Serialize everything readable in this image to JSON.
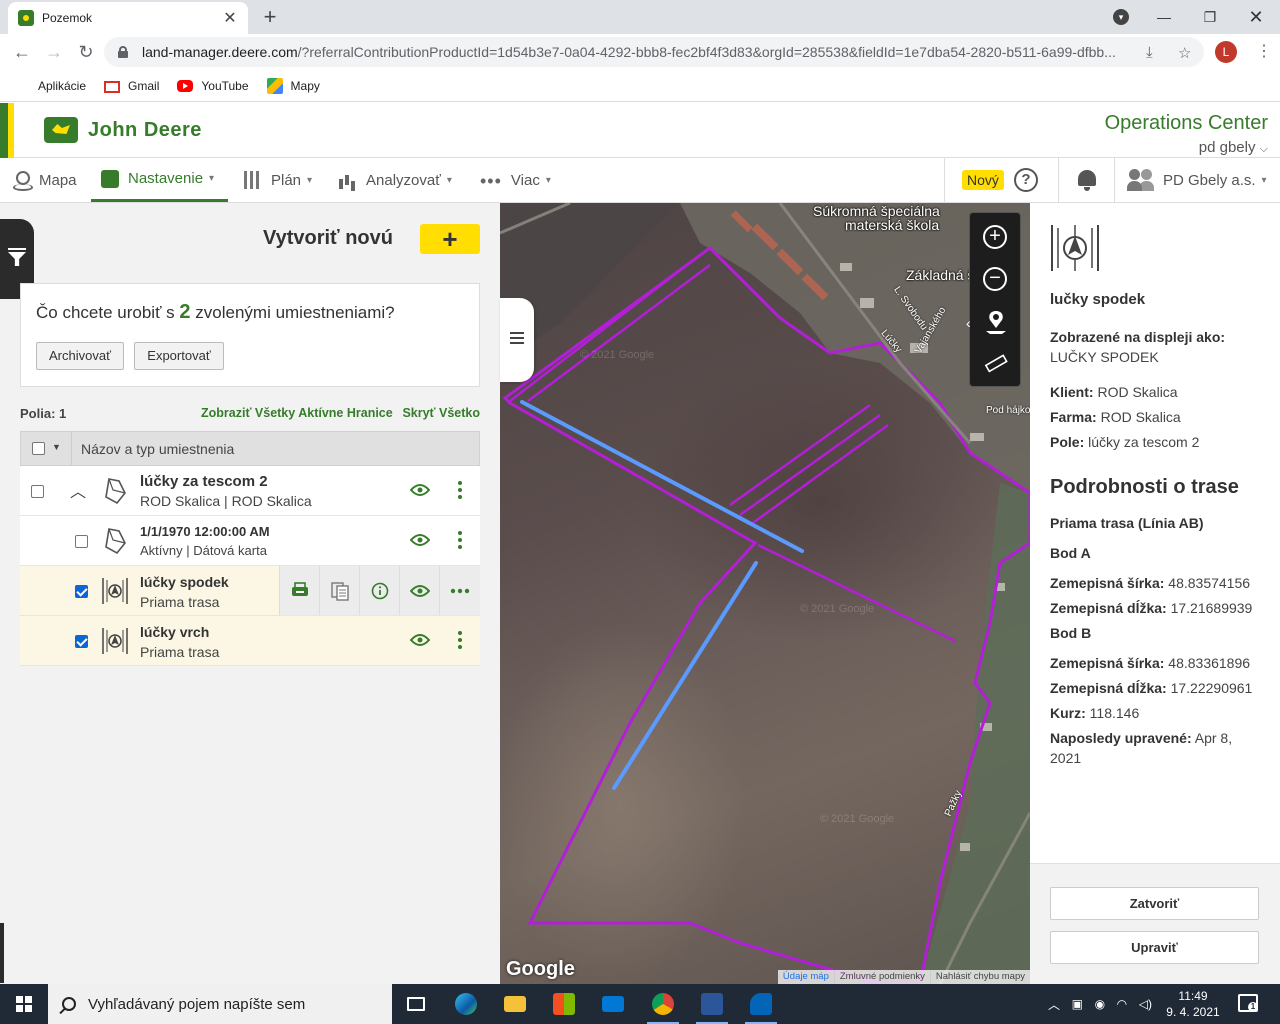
{
  "browser": {
    "tab_title": "Pozemok",
    "url_host": "land-manager.deere.com",
    "url_rest": "/?referralContributionProductId=1d54b3e7-0a04-4292-bbb8-fec2bf4f3d83&orgId=285538&fieldId=1e7dba54-2820-b511-6a99-dfbb...",
    "avatar_letter": "L",
    "bookmarks": [
      {
        "label": "Aplikácie",
        "icon": "apps-grid-icon"
      },
      {
        "label": "Gmail",
        "icon": "gmail-icon"
      },
      {
        "label": "YouTube",
        "icon": "youtube-icon"
      },
      {
        "label": "Mapy",
        "icon": "maps-icon"
      }
    ]
  },
  "header": {
    "brand": "John Deere",
    "product": "Operations Center",
    "org_selector": "pd gbely"
  },
  "nav": {
    "items": [
      {
        "label": "Mapa"
      },
      {
        "label": "Nastavenie"
      },
      {
        "label": "Plán"
      },
      {
        "label": "Analyzovať"
      },
      {
        "label": "Viac"
      }
    ],
    "new_badge": "Nový",
    "help": "?",
    "org": "PD Gbely a.s."
  },
  "left": {
    "create_title": "Vytvoriť novú",
    "create_plus": "+",
    "selection_question_pre": "Čo chcete urobiť s",
    "selection_count": "2",
    "selection_question_post": "zvolenými umiestneniami?",
    "archive_btn": "Archivovať",
    "export_btn": "Exportovať",
    "polia_count": "Polia: 1",
    "show_all_link": "Zobraziť Všetky Aktívne Hranice",
    "hide_all_link": "Skryť Všetko",
    "list_header": "Názov a typ umiestnenia",
    "rows": [
      {
        "title": "lúčky za tescom 2",
        "sub1": "ROD Skalica",
        "sub2": "ROD Skalica"
      },
      {
        "title": "1/1/1970 12:00:00 AM",
        "sub": "Aktívny | Dátová karta"
      },
      {
        "title": "lúčky spodek",
        "sub": "Priama trasa",
        "checked": true
      },
      {
        "title": "lúčky vrch",
        "sub": "Priama trasa",
        "checked": true
      }
    ]
  },
  "map": {
    "labels": [
      "Súkromná špeciálna",
      "materská škola",
      "Základná šk",
      "L. Svobodu",
      "Vajanského",
      "Lúčky",
      "Pod hájko",
      "Pažky"
    ],
    "google": "Google",
    "footer": [
      "Údaje máp",
      "Zmluvné podmienky",
      "Nahlásiť chybu mapy"
    ],
    "watermark": "© 2021 Google",
    "boundary_color": "#b21fd6",
    "track_color": "#5b9bff"
  },
  "details": {
    "name": "lučky spodek",
    "display_label": "Zobrazené na displeji ako:",
    "display_value": "LUČKY SPODEK",
    "client_label": "Klient:",
    "client": "ROD Skalica",
    "farm_label": "Farma:",
    "farm": "ROD Skalica",
    "field_label": "Pole:",
    "field": "lúčky za tescom 2",
    "section_title": "Podrobnosti o trase",
    "track_type": "Priama trasa (Línia AB)",
    "point_a": "Bod A",
    "lat_label": "Zemepisná šírka:",
    "lon_label": "Zemepisná dĺžka:",
    "a_lat": "48.83574156",
    "a_lon": "17.21689939",
    "point_b": "Bod B",
    "b_lat": "48.83361896",
    "b_lon": "17.22290961",
    "heading_label": "Kurz:",
    "heading": "118.146",
    "modified_label": "Naposledy upravené:",
    "modified": "Apr 8, 2021",
    "close_btn": "Zatvoriť",
    "edit_btn": "Upraviť"
  },
  "taskbar": {
    "search_placeholder": "Vyhľadávaný pojem napíšte sem",
    "time": "11:49",
    "date": "9. 4. 2021"
  }
}
